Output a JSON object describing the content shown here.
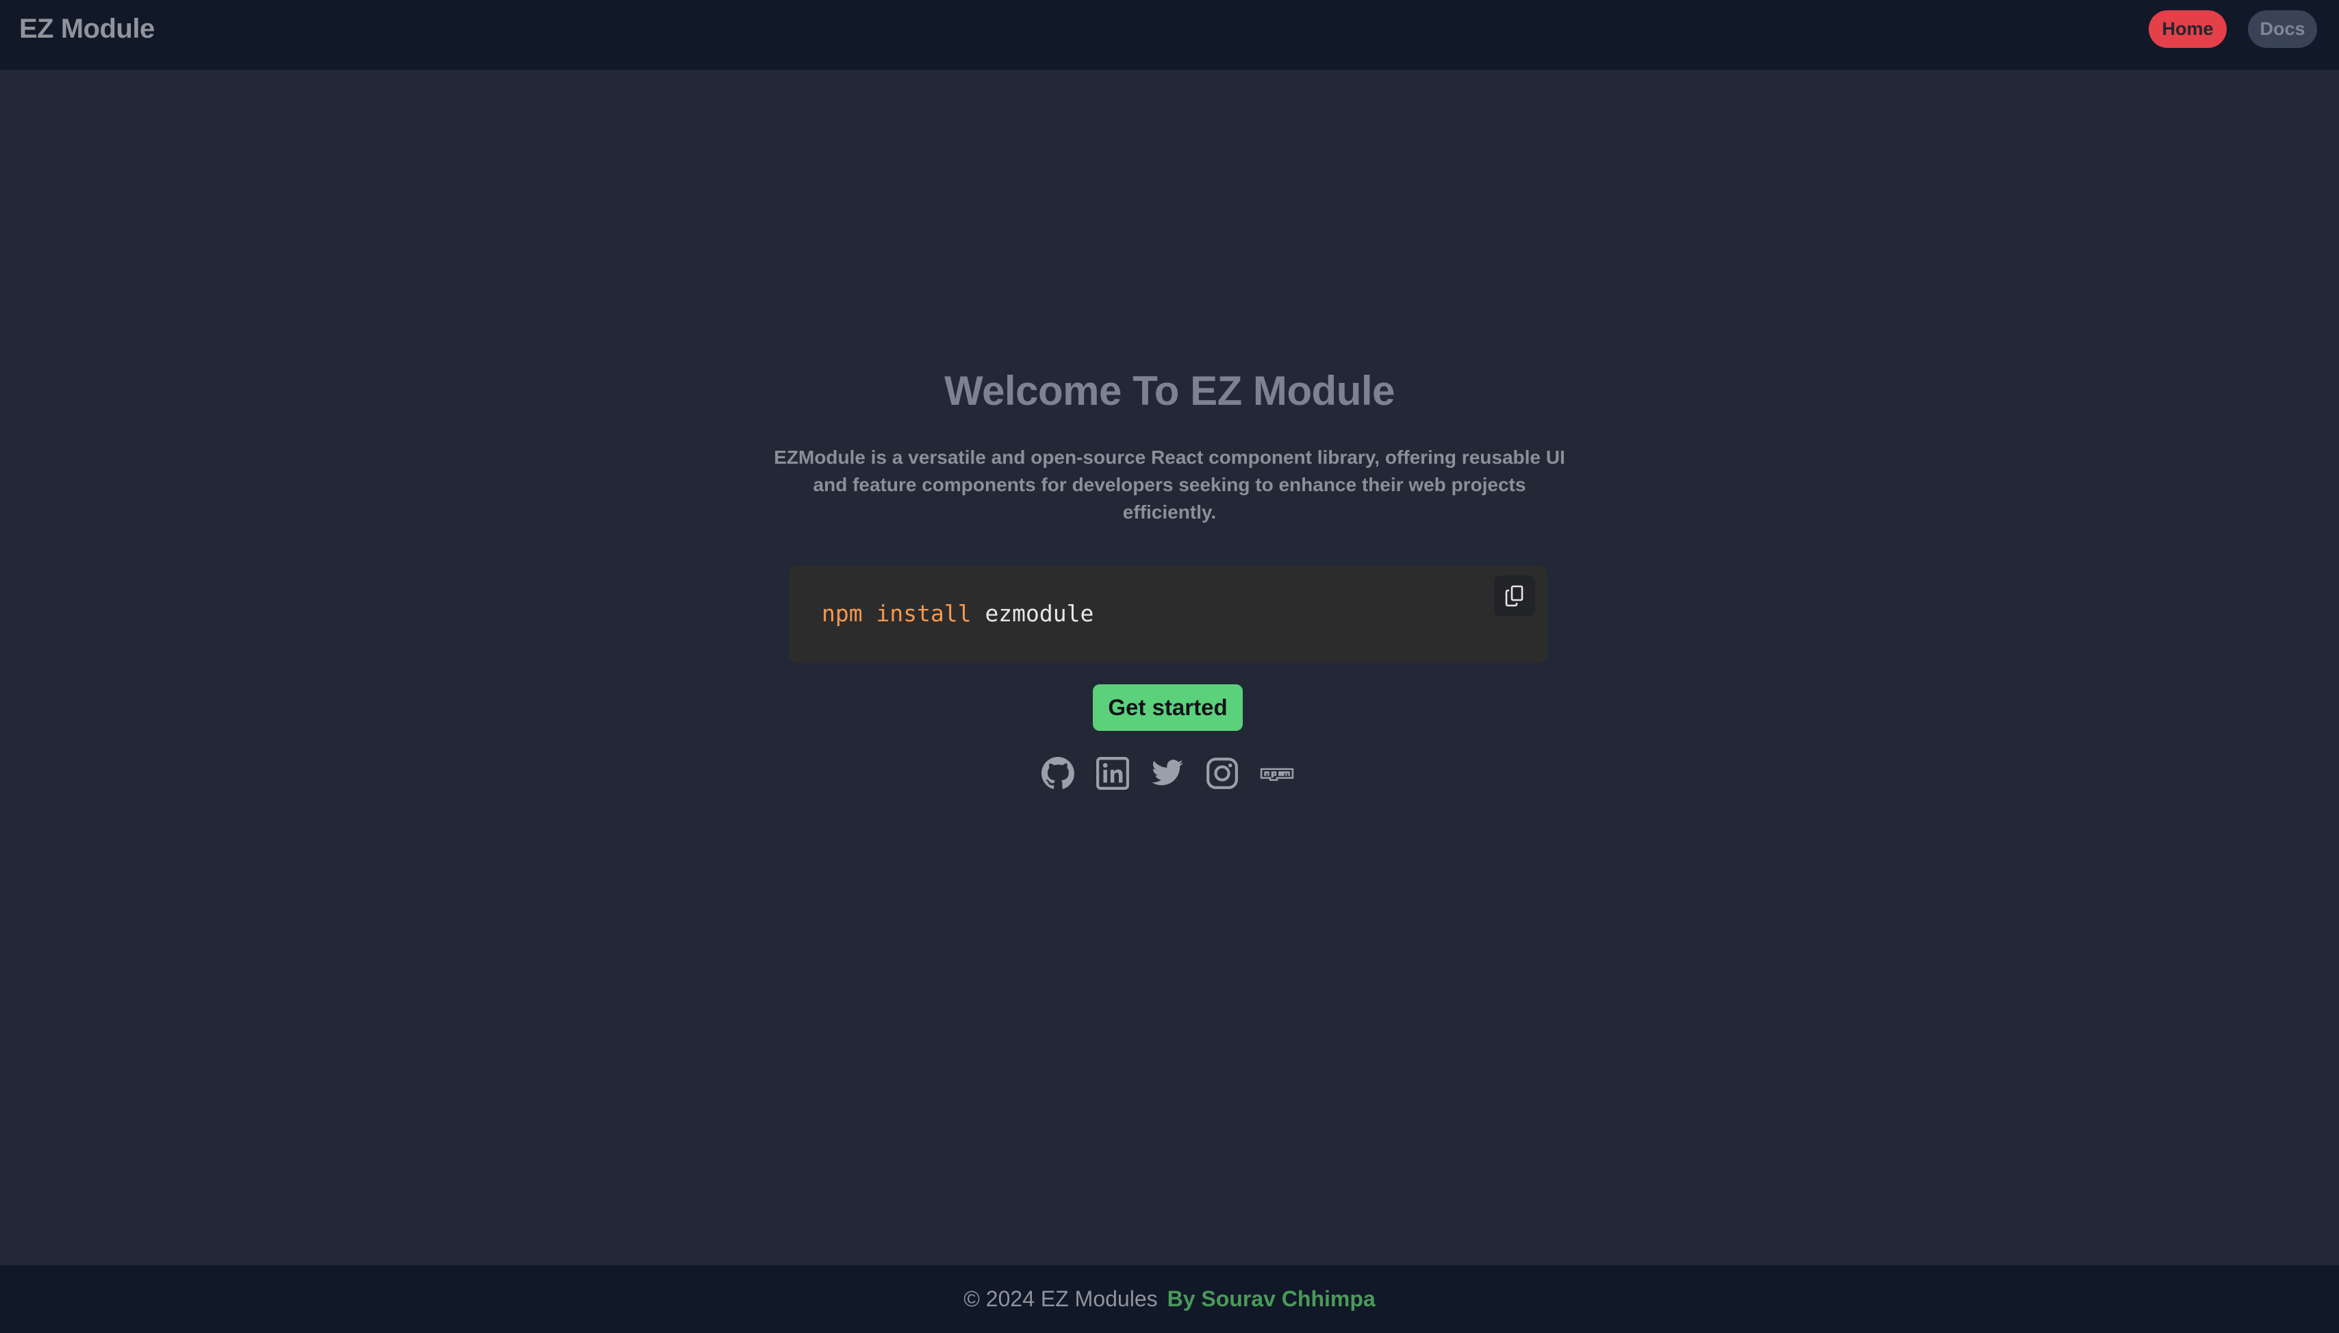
{
  "header": {
    "brand": "EZ Module",
    "nav": [
      {
        "label": "Home",
        "active": true
      },
      {
        "label": "Docs",
        "active": false
      }
    ]
  },
  "hero": {
    "title": "Welcome To EZ Module",
    "description_lines": [
      "EZModule is a versatile and open-source React component library, offering reusable UI",
      "and feature components for developers seeking to enhance their web projects",
      "efficiently."
    ]
  },
  "install": {
    "tokens": [
      "npm",
      "install",
      "ezmodule"
    ],
    "copy_icon": "copy-icon"
  },
  "cta": {
    "label": "Get started"
  },
  "social": [
    "github-icon",
    "linkedin-icon",
    "twitter-icon",
    "instagram-icon",
    "npm-icon"
  ],
  "footer": {
    "copyright": "© 2024 EZ Modules",
    "author": "By Sourav Chhimpa"
  },
  "colors": {
    "header_bg": "#111827",
    "page_bg": "#222836",
    "home_pill": "#e3404a",
    "docs_pill": "#3a4356",
    "code_bg": "#2d2c2c",
    "code_keyword": "#f5994f",
    "cta_bg": "#5bd17b",
    "footer_author": "#4a9a5a"
  }
}
